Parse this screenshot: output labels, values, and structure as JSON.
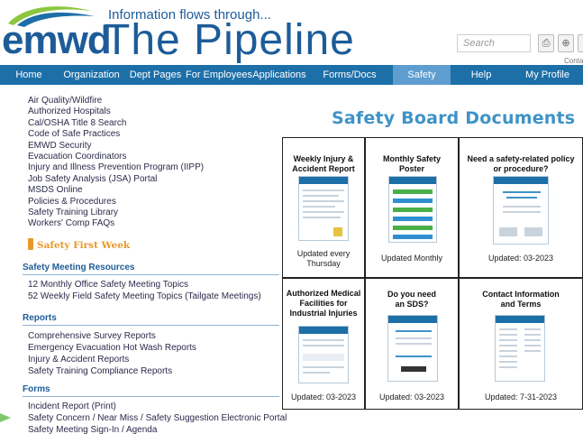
{
  "header": {
    "logo_text": "emwd",
    "tagline": "Information flows through...",
    "site_title": "The Pipeline",
    "search_placeholder": "Search",
    "contact_label": "Contact",
    "colors": {
      "brand_blue": "#1d5c99",
      "nav_blue": "#1d6fa8",
      "nav_active": "#5d9dd0",
      "logo_green": "#8cc63f"
    }
  },
  "nav": {
    "items": [
      {
        "label": "Home"
      },
      {
        "label": "Organization"
      },
      {
        "label": "Dept Pages"
      },
      {
        "label": "For Employees"
      },
      {
        "label": "Applications"
      },
      {
        "label": "Forms/Docs"
      },
      {
        "label": "Safety",
        "active": true
      },
      {
        "label": "Help"
      },
      {
        "label": "My Profile"
      }
    ]
  },
  "sidebar": {
    "links": [
      "Air Quality/Wildfire",
      "Authorized Hospitals",
      "Cal/OSHA Title 8 Search",
      "Code of Safe Practices",
      "EMWD Security",
      "Evacuation Coordinators",
      "Injury and Illness Prevention Program (IIPP)",
      "Job Safety Analysis (JSA) Portal",
      "MSDS Online",
      "Policies & Procedures",
      "Safety Training Library",
      "Workers' Comp FAQs"
    ],
    "safety_first": "Safety First Week",
    "meeting_resources": {
      "title": "Safety Meeting Resources",
      "links": [
        "12 Monthly Office Safety Meeting Topics",
        "52 Weekly Field Safety Meeting Topics (Tailgate Meetings)"
      ]
    },
    "reports": {
      "title": "Reports",
      "links": [
        "Comprehensive Survey Reports",
        "Emergency Evacuation Hot Wash Reports",
        "Injury & Accident Reports",
        "Safety Training Compliance Reports"
      ]
    },
    "forms": {
      "title": "Forms",
      "links": [
        "Incident Report (Print)",
        "Safety Concern / Near Miss / Safety Suggestion Electronic Portal",
        "Safety Meeting Sign-In / Agenda"
      ]
    }
  },
  "main": {
    "title": "Safety Board Documents",
    "cards": [
      {
        "title": "Weekly Injury & Accident Report",
        "caption": "Updated every Thursday"
      },
      {
        "title": "Monthly Safety Poster",
        "caption": "Updated Monthly"
      },
      {
        "title": "Need a safety-related policy or procedure?",
        "caption": "Updated: 03-2023"
      },
      {
        "title": "Authorized Medical Facilities for Industrial Injuries",
        "caption": "Updated: 03-2023"
      },
      {
        "title": "Do you need an SDS?",
        "caption": "Updated: 03-2023"
      },
      {
        "title": "Contact Information and Terms",
        "caption": "Updated: 7-31-2023"
      }
    ]
  }
}
